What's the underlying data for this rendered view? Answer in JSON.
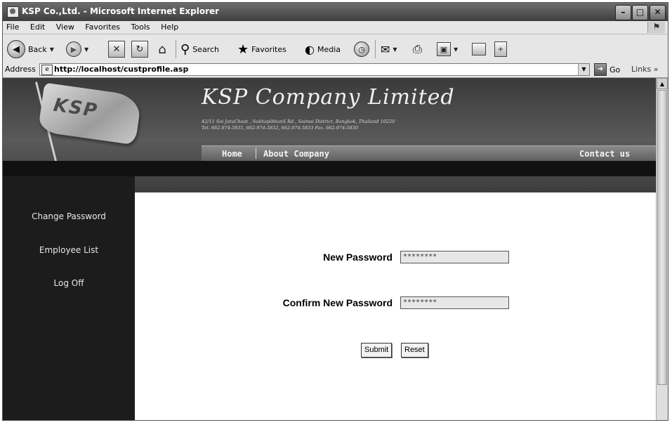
{
  "window": {
    "title": "KSP Co.,Ltd. - Microsoft Internet Explorer"
  },
  "menu": [
    "File",
    "Edit",
    "View",
    "Favorites",
    "Tools",
    "Help"
  ],
  "toolbar": {
    "back_label": "Back",
    "search_label": "Search",
    "favorites_label": "Favorites",
    "media_label": "Media"
  },
  "address": {
    "label": "Address",
    "url": "http://localhost/custprofile.asp",
    "go_label": "Go",
    "links_label": "Links »"
  },
  "page": {
    "logo_text": "KSP",
    "company_name": "KSP Company Limited",
    "address_line1": "42/11 Soi JatuChoat , SukhapibhanS Rd., Saimai District, Bangkok, Thailand 10220",
    "address_line2": "Tel. 662-974-5831, 662-974-5832, 662-974-5833  Fax. 662-974-5830",
    "nav": {
      "home": "Home",
      "about": "About Company",
      "contact": "Contact us"
    },
    "sidebar": [
      "Change Password",
      "Employee List",
      "Log Off"
    ],
    "form": {
      "new_password_label": "New Password",
      "new_password_value": "********",
      "confirm_password_label": "Confirm New Password",
      "confirm_password_value": "********",
      "submit_label": "Submit",
      "reset_label": "Reset"
    }
  }
}
